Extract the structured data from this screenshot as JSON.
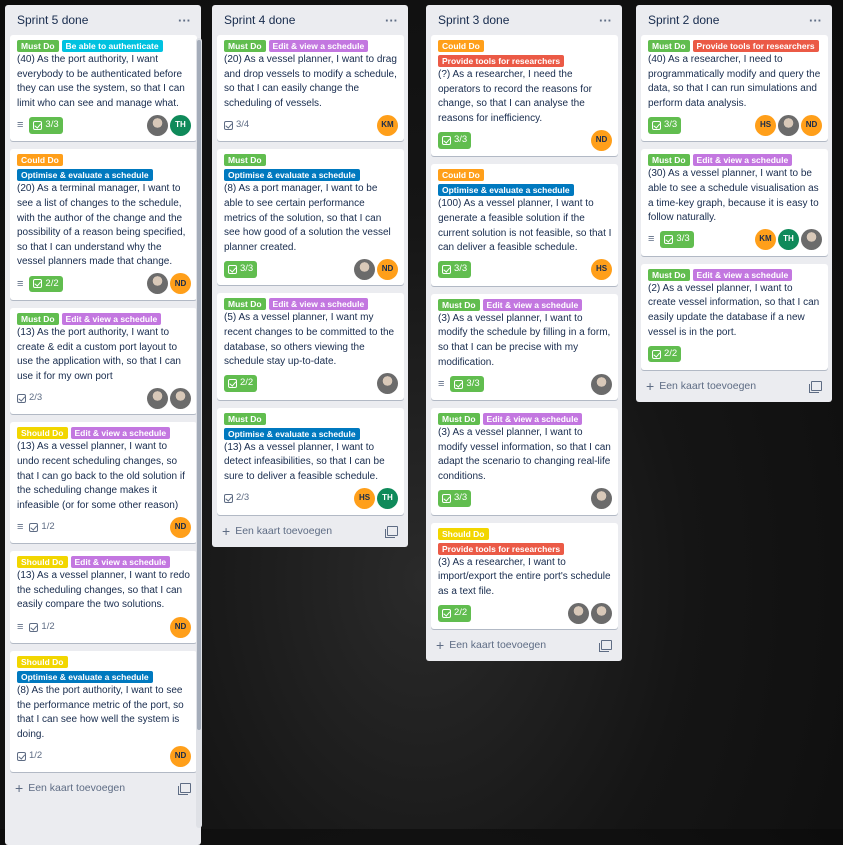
{
  "lists": [
    {
      "title": "Sprint 5 done",
      "cards": [
        {
          "labels": [
            {
              "text": "Must Do",
              "cls": "l-must"
            },
            {
              "text": "Be able to authenticate",
              "cls": "l-auth"
            }
          ],
          "text": "(40) As the port authority, I want everybody to be authenticated before they can use the system, so that I can limit who can see and manage what.",
          "desc": true,
          "checklist": "3/3",
          "complete": true,
          "members": [
            {
              "initials": "",
              "photo": true
            },
            {
              "initials": "TH",
              "cls": "av-th"
            }
          ]
        },
        {
          "labels": [
            {
              "text": "Could Do",
              "cls": "l-could"
            },
            {
              "text": "Optimise & evaluate a schedule",
              "cls": "l-opt"
            }
          ],
          "text": "(20) As a terminal manager, I want to see a list of changes to the schedule, with the author of the change and the possibility of a reason being specified, so that I can understand why the vessel planners made that change.",
          "desc": true,
          "checklist": "2/2",
          "complete": true,
          "members": [
            {
              "initials": "",
              "photo": true
            },
            {
              "initials": "ND",
              "cls": "av-nd"
            }
          ]
        },
        {
          "labels": [
            {
              "text": "Must Do",
              "cls": "l-must"
            },
            {
              "text": "Edit & view a schedule",
              "cls": "l-edit"
            }
          ],
          "text": "(13) As the port authority, I want to create & edit a custom port layout to use the application with, so that I can use it for my own port",
          "desc": false,
          "checklist": "2/3",
          "complete": false,
          "members": [
            {
              "initials": "",
              "photo": true
            },
            {
              "initials": "",
              "photo": true
            }
          ]
        },
        {
          "labels": [
            {
              "text": "Should Do",
              "cls": "l-should"
            },
            {
              "text": "Edit & view a schedule",
              "cls": "l-edit"
            }
          ],
          "text": "(13) As a vessel planner, I want to undo recent scheduling changes, so that I can go back to the old solution if the scheduling change makes it infeasible (or for some other reason)",
          "desc": true,
          "checklist": "1/2",
          "complete": false,
          "members": [
            {
              "initials": "ND",
              "cls": "av-nd"
            }
          ]
        },
        {
          "labels": [
            {
              "text": "Should Do",
              "cls": "l-should"
            },
            {
              "text": "Edit & view a schedule",
              "cls": "l-edit"
            }
          ],
          "text": "(13) As a vessel planner, I want to redo the scheduling changes, so that I can easily compare the two solutions.",
          "desc": true,
          "checklist": "1/2",
          "complete": false,
          "members": [
            {
              "initials": "ND",
              "cls": "av-nd"
            }
          ]
        },
        {
          "labels": [
            {
              "text": "Should Do",
              "cls": "l-should"
            },
            {
              "text": "Optimise & evaluate a schedule",
              "cls": "l-opt"
            }
          ],
          "text": "(8) As the port authority, I want to see the performance metric of the port, so that I can see how well the system is doing.",
          "desc": false,
          "checklist": "1/2",
          "complete": false,
          "members": [
            {
              "initials": "ND",
              "cls": "av-nd"
            }
          ]
        }
      ],
      "add_label": "Een kaart toevoegen"
    },
    {
      "title": "Sprint 4 done",
      "cards": [
        {
          "labels": [
            {
              "text": "Must Do",
              "cls": "l-must"
            },
            {
              "text": "Edit & view a schedule",
              "cls": "l-edit"
            }
          ],
          "text": "(20) As a vessel planner, I want to drag and drop vessels to modify a schedule, so that I can easily change the scheduling of vessels.",
          "desc": false,
          "checklist": "3/4",
          "complete": false,
          "members": [
            {
              "initials": "KM",
              "cls": "av-km"
            }
          ]
        },
        {
          "labels": [
            {
              "text": "Must Do",
              "cls": "l-must"
            },
            {
              "text": "Optimise & evaluate a schedule",
              "cls": "l-opt"
            }
          ],
          "text": "(8) As a port manager, I want to be able to see certain performance metrics of the solution, so that I can see how good of a solution the vessel planner created.",
          "desc": false,
          "checklist": "3/3",
          "complete": true,
          "members": [
            {
              "initials": "",
              "photo": true
            },
            {
              "initials": "ND",
              "cls": "av-nd"
            }
          ]
        },
        {
          "labels": [
            {
              "text": "Must Do",
              "cls": "l-must"
            },
            {
              "text": "Edit & view a schedule",
              "cls": "l-edit"
            }
          ],
          "text": "(5) As a vessel planner, I want my recent changes to be committed to the database, so others viewing the schedule stay up-to-date.",
          "desc": false,
          "checklist": "2/2",
          "complete": true,
          "members": [
            {
              "initials": "",
              "photo": true
            }
          ]
        },
        {
          "labels": [
            {
              "text": "Must Do",
              "cls": "l-must"
            },
            {
              "text": "Optimise & evaluate a schedule",
              "cls": "l-opt"
            }
          ],
          "text": "(13) As a vessel planner, I want to detect infeasibilities, so that I can be sure to deliver a feasible schedule.",
          "desc": false,
          "checklist": "2/3",
          "complete": false,
          "members": [
            {
              "initials": "HS",
              "cls": "av-hs"
            },
            {
              "initials": "TH",
              "cls": "av-th"
            }
          ]
        }
      ],
      "add_label": "Een kaart toevoegen"
    },
    {
      "title": "Sprint 3 done",
      "cards": [
        {
          "labels": [
            {
              "text": "Could Do",
              "cls": "l-could"
            },
            {
              "text": "Provide tools for researchers",
              "cls": "l-prov"
            }
          ],
          "text": "(?) As a researcher, I need the operators to record the reasons for change, so that I can analyse the reasons for inefficiency.",
          "desc": false,
          "checklist": "3/3",
          "complete": true,
          "members": [
            {
              "initials": "ND",
              "cls": "av-nd"
            }
          ]
        },
        {
          "labels": [
            {
              "text": "Could Do",
              "cls": "l-could"
            },
            {
              "text": "Optimise & evaluate a schedule",
              "cls": "l-opt"
            }
          ],
          "text": "(100) As a vessel planner, I want to generate a feasible solution if the current solution is not feasible, so that I can deliver a feasible schedule.",
          "desc": false,
          "checklist": "3/3",
          "complete": true,
          "members": [
            {
              "initials": "HS",
              "cls": "av-hs"
            }
          ]
        },
        {
          "labels": [
            {
              "text": "Must Do",
              "cls": "l-must"
            },
            {
              "text": "Edit & view a schedule",
              "cls": "l-edit"
            }
          ],
          "text": "(3) As a vessel planner, I want to modify the schedule by filling in a form, so that I can be precise with my modification.",
          "desc": true,
          "checklist": "3/3",
          "complete": true,
          "members": [
            {
              "initials": "",
              "photo": true
            }
          ]
        },
        {
          "labels": [
            {
              "text": "Must Do",
              "cls": "l-must"
            },
            {
              "text": "Edit & view a schedule",
              "cls": "l-edit"
            }
          ],
          "text": "(3) As a vessel planner, I want to modify vessel information, so that I can adapt the scenario to changing real-life conditions.",
          "desc": false,
          "checklist": "3/3",
          "complete": true,
          "members": [
            {
              "initials": "",
              "photo": true
            }
          ]
        },
        {
          "labels": [
            {
              "text": "Should Do",
              "cls": "l-should"
            },
            {
              "text": "Provide tools for researchers",
              "cls": "l-prov"
            }
          ],
          "text": "(3) As a researcher, I want to import/export the entire port's schedule as a text file.",
          "desc": false,
          "checklist": "2/2",
          "complete": true,
          "members": [
            {
              "initials": "",
              "photo": true
            },
            {
              "initials": "",
              "photo": true
            }
          ]
        }
      ],
      "add_label": "Een kaart toevoegen"
    },
    {
      "title": "Sprint 2 done",
      "cards": [
        {
          "labels": [
            {
              "text": "Must Do",
              "cls": "l-must"
            },
            {
              "text": "Provide tools for researchers",
              "cls": "l-prov"
            }
          ],
          "text": "(40) As a researcher, I need to programmatically modify and query the data, so that I can run simulations and perform data analysis.",
          "desc": false,
          "checklist": "3/3",
          "complete": true,
          "members": [
            {
              "initials": "HS",
              "cls": "av-hs"
            },
            {
              "initials": "",
              "photo": true
            },
            {
              "initials": "ND",
              "cls": "av-nd"
            }
          ]
        },
        {
          "labels": [
            {
              "text": "Must Do",
              "cls": "l-must"
            },
            {
              "text": "Edit & view a schedule",
              "cls": "l-edit"
            }
          ],
          "text": "(30) As a vessel planner, I want to be able to see a schedule visualisation as a time-key graph, because it is easy to follow naturally.",
          "desc": true,
          "checklist": "3/3",
          "complete": true,
          "members": [
            {
              "initials": "KM",
              "cls": "av-km"
            },
            {
              "initials": "TH",
              "cls": "av-th"
            },
            {
              "initials": "",
              "photo": true
            }
          ]
        },
        {
          "labels": [
            {
              "text": "Must Do",
              "cls": "l-must"
            },
            {
              "text": "Edit & view a schedule",
              "cls": "l-edit"
            }
          ],
          "text": "(2) As a vessel planner, I want to create vessel information, so that I can easily update the database if a new vessel is in the port.",
          "desc": false,
          "checklist": "2/2",
          "complete": true,
          "members": []
        }
      ],
      "add_label": "Een kaart toevoegen"
    }
  ]
}
